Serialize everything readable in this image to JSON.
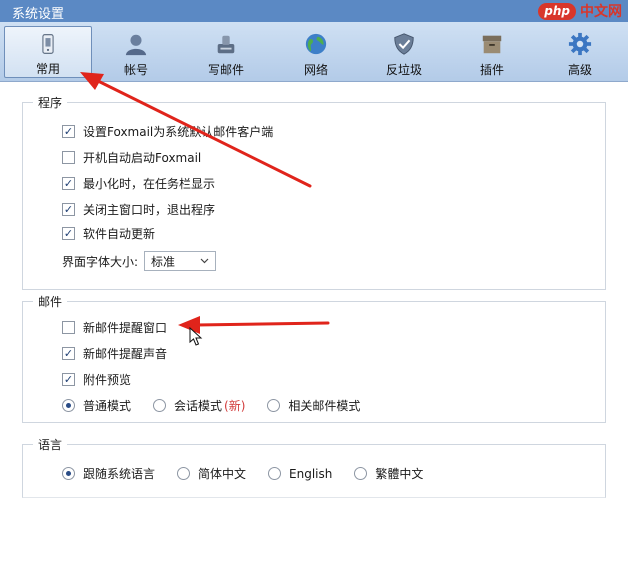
{
  "window": {
    "title": "系统设置"
  },
  "watermark": {
    "badge": "php",
    "text": "中文网"
  },
  "toolbar": {
    "items": [
      {
        "label": "常用",
        "icon": "phone-device-icon"
      },
      {
        "label": "帐号",
        "icon": "user-icon"
      },
      {
        "label": "写邮件",
        "icon": "compose-icon"
      },
      {
        "label": "网络",
        "icon": "globe-icon"
      },
      {
        "label": "反垃圾",
        "icon": "shield-icon"
      },
      {
        "label": "插件",
        "icon": "box-icon"
      },
      {
        "label": "高级",
        "icon": "gear-icon"
      }
    ],
    "active_index": 0
  },
  "program": {
    "title": "程序",
    "options": [
      {
        "label": "设置Foxmail为系统默认邮件客户端",
        "checked": true
      },
      {
        "label": "开机自动启动Foxmail",
        "checked": false
      },
      {
        "label": "最小化时，在任务栏显示",
        "checked": true
      },
      {
        "label": "关闭主窗口时，退出程序",
        "checked": true
      },
      {
        "label": "软件自动更新",
        "checked": true
      }
    ],
    "font_size_label": "界面字体大小:",
    "font_size_value": "标准"
  },
  "mail": {
    "title": "邮件",
    "options": [
      {
        "label": "新邮件提醒窗口",
        "checked": false
      },
      {
        "label": "新邮件提醒声音",
        "checked": true
      },
      {
        "label": "附件预览",
        "checked": true
      }
    ],
    "modes": [
      {
        "label": "普通模式",
        "selected": true
      },
      {
        "label": "会话模式",
        "selected": false,
        "tag": "(新)"
      },
      {
        "label": "相关邮件模式",
        "selected": false
      }
    ]
  },
  "language": {
    "title": "语言",
    "options": [
      {
        "label": "跟随系统语言",
        "selected": true
      },
      {
        "label": "简体中文",
        "selected": false
      },
      {
        "label": "English",
        "selected": false
      },
      {
        "label": "繁體中文",
        "selected": false
      }
    ]
  },
  "colors": {
    "titlebar": "#5b89c4",
    "toolbar": "#bcd2ec",
    "annotation_arrow": "#e0241b",
    "new_tag": "#d23b3b"
  }
}
